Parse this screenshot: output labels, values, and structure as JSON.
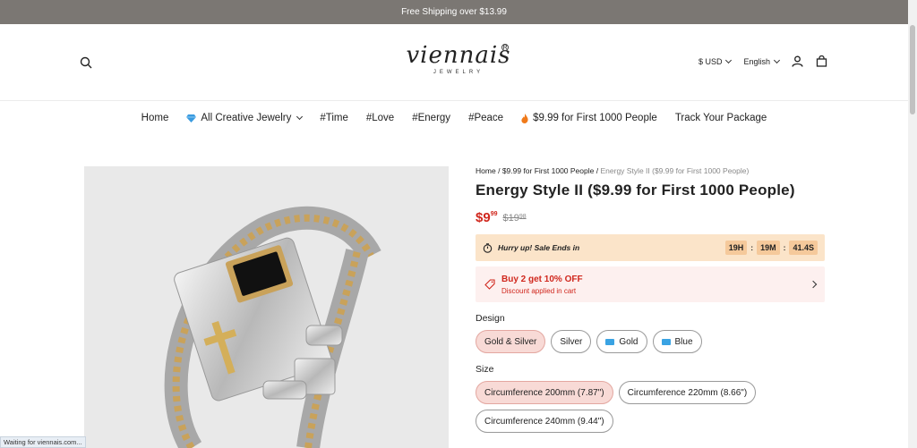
{
  "announcement": "Free Shipping over $13.99",
  "header": {
    "logo_text": "viennais",
    "logo_reg": "R",
    "logo_sub": "JEWELRY",
    "currency": "$ USD",
    "language": "English"
  },
  "nav": {
    "items": [
      "Home",
      "All Creative Jewelry",
      "#Time",
      "#Love",
      "#Energy",
      "#Peace",
      "$9.99 for First 1000 People",
      "Track Your Package"
    ]
  },
  "product": {
    "breadcrumb": {
      "home": "Home",
      "sep": "/",
      "category": "$9.99 for First 1000 People",
      "current": "Energy Style II ($9.99 for First 1000 People)"
    },
    "title": "Energy Style II ($9.99 for First 1000 People)",
    "price_now_main": "$9",
    "price_now_cents": "99",
    "price_was_main": "$19",
    "price_was_cents": "98",
    "sale_text": "Hurry up! Sale Ends in",
    "timer": {
      "hours": "19H",
      "minutes": "19M",
      "seconds": "41.4S",
      "sep": ":"
    },
    "offer_title": "Buy 2 get 10% OFF",
    "offer_sub": "Discount applied in cart",
    "design_label": "Design",
    "design_options": [
      "Gold & Silver",
      "Silver",
      "Gold",
      "Blue"
    ],
    "design_selected": "Gold & Silver",
    "size_label": "Size",
    "size_options": [
      "Circumference 200mm (7.87\")",
      "Circumference 220mm (8.66\")",
      "Circumference 240mm (9.44\")"
    ],
    "size_selected": "Circumference 200mm (7.87\")"
  },
  "colors": {
    "accent_red": "#d0271d",
    "topbar": "#7b7773",
    "sale_bg": "#fbe4c9",
    "selected_option_bg": "#f8dad6"
  },
  "icons": [
    "search-icon",
    "user-icon",
    "bag-icon",
    "diamond-icon",
    "fire-icon",
    "stopwatch-icon",
    "tag-icon",
    "chevron-right-icon"
  ],
  "status_bar": "Waiting for viennais.com..."
}
